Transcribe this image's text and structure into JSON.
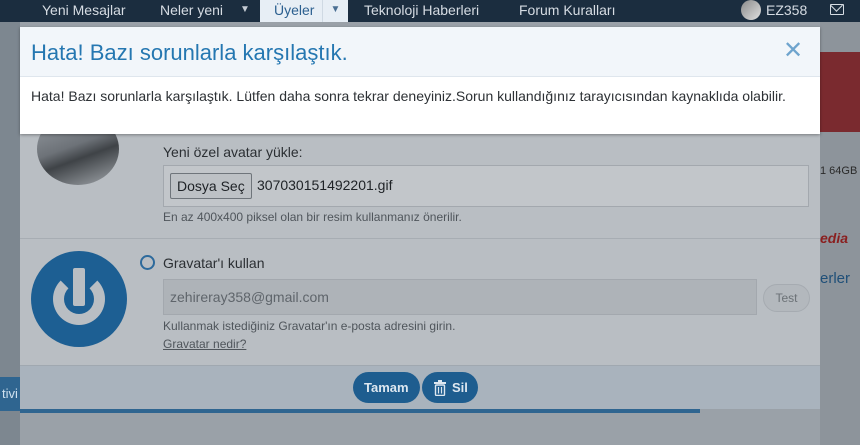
{
  "nav": {
    "items": [
      {
        "label": "Yeni Mesajlar"
      },
      {
        "label": "Neler yeni"
      },
      {
        "label": "Üyeler"
      },
      {
        "label": "Teknoloji Haberleri"
      },
      {
        "label": "Forum Kuralları"
      }
    ],
    "caret": "▼",
    "username": "EZ358"
  },
  "background": {
    "left_tab_text": "tivi",
    "right_text_1": "1 64GB",
    "right_text_2": "edia",
    "right_text_3": "erler"
  },
  "editor": {
    "upload_label": "Yeni özel avatar yükle:",
    "file_button": "Dosya Seç",
    "file_name": "307030151492201.gif",
    "upload_hint": "En az 400x400 piksel olan bir resim kullanmanız önerilir.",
    "gravatar_label": "Gravatar'ı kullan",
    "email_value": "zehireray358@gmail.com",
    "test_button": "Test",
    "gravatar_hint": "Kullanmak istediğiniz Gravatar'ın e-posta adresini girin.",
    "gravatar_link": "Gravatar nedir?",
    "done_button": "Tamam",
    "delete_button": "Sil"
  },
  "dialog": {
    "title": "Hata! Bazı sorunlarla karşılaştık.",
    "close": "✕",
    "message": "Hata! Bazı sorunlarla karşılaştık. Lütfen daha sonra tekrar deneyiniz.Sorun kullandığınız tarayıcısından kaynaklıda olabilir."
  },
  "colors": {
    "nav_bg": "#1b2d3f",
    "accent": "#2577b1",
    "button_bg": "#1e5d8f"
  }
}
